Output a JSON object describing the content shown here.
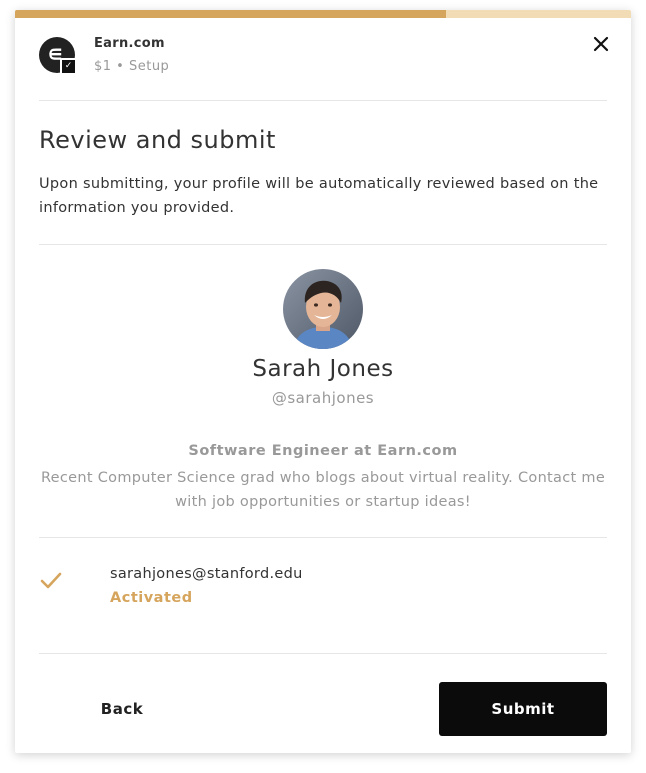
{
  "header": {
    "app_name": "Earn.com",
    "subtitle": "$1 • Setup",
    "progress": 0.7
  },
  "main": {
    "title": "Review and submit",
    "description": "Upon submitting, your profile will be automatically reviewed based on the information you provided."
  },
  "profile": {
    "name": "Sarah Jones",
    "handle": "@sarahjones",
    "headline": "Software Engineer at Earn.com",
    "bio": "Recent Computer Science grad who blogs about virtual reality. Contact me with job opportunities or startup ideas!"
  },
  "verification": {
    "email": "sarahjones@stanford.edu",
    "status": "Activated"
  },
  "footer": {
    "back_label": "Back",
    "submit_label": "Submit"
  },
  "colors": {
    "accent": "#d6a55d",
    "accent_light": "#f2dcb6",
    "primary_button": "#0b0b0b"
  },
  "icons": {
    "close": "close-icon",
    "check": "checkmark-icon",
    "logo": "earn-logo-icon"
  }
}
